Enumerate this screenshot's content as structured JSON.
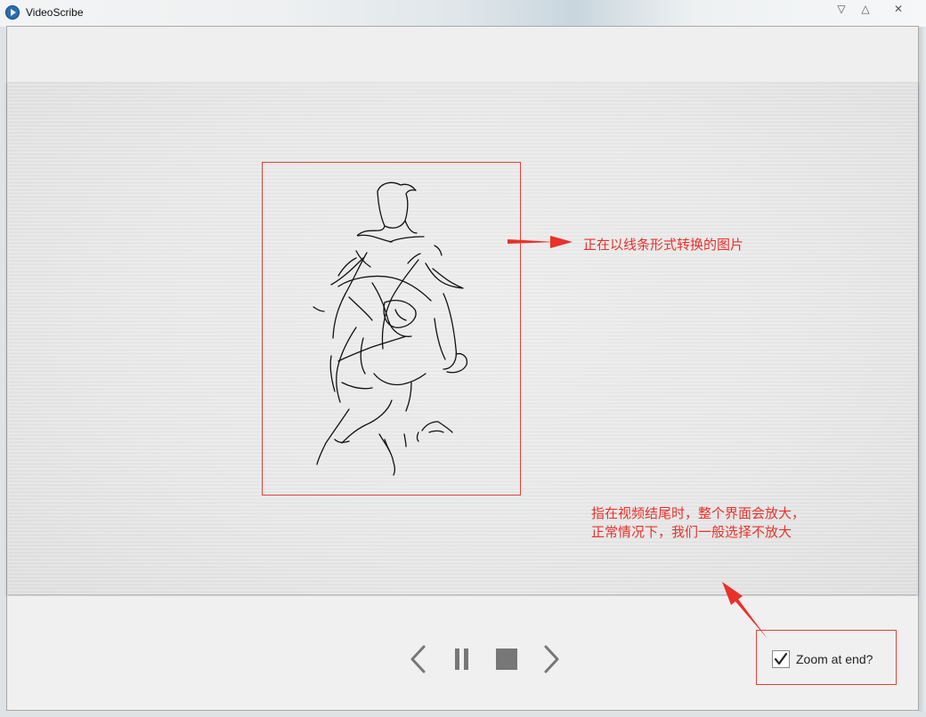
{
  "window": {
    "title": "VideoScribe",
    "minimize_glyph": "▽",
    "maximize_glyph": "△",
    "close_glyph": "✕"
  },
  "annotations": {
    "sketch_note": "正在以线条形式转换的图片",
    "zoom_note_line1": "指在视频结尾时，整个界面会放大，",
    "zoom_note_line2": "正常情况下，我们一般选择不放大",
    "accent_color": "#e8312b"
  },
  "controls": {
    "previous_icon": "chevron-left-icon",
    "pause_icon": "pause-icon",
    "stop_icon": "stop-icon",
    "next_icon": "chevron-right-icon"
  },
  "zoom_option": {
    "label": "Zoom at end?",
    "checked": true
  }
}
